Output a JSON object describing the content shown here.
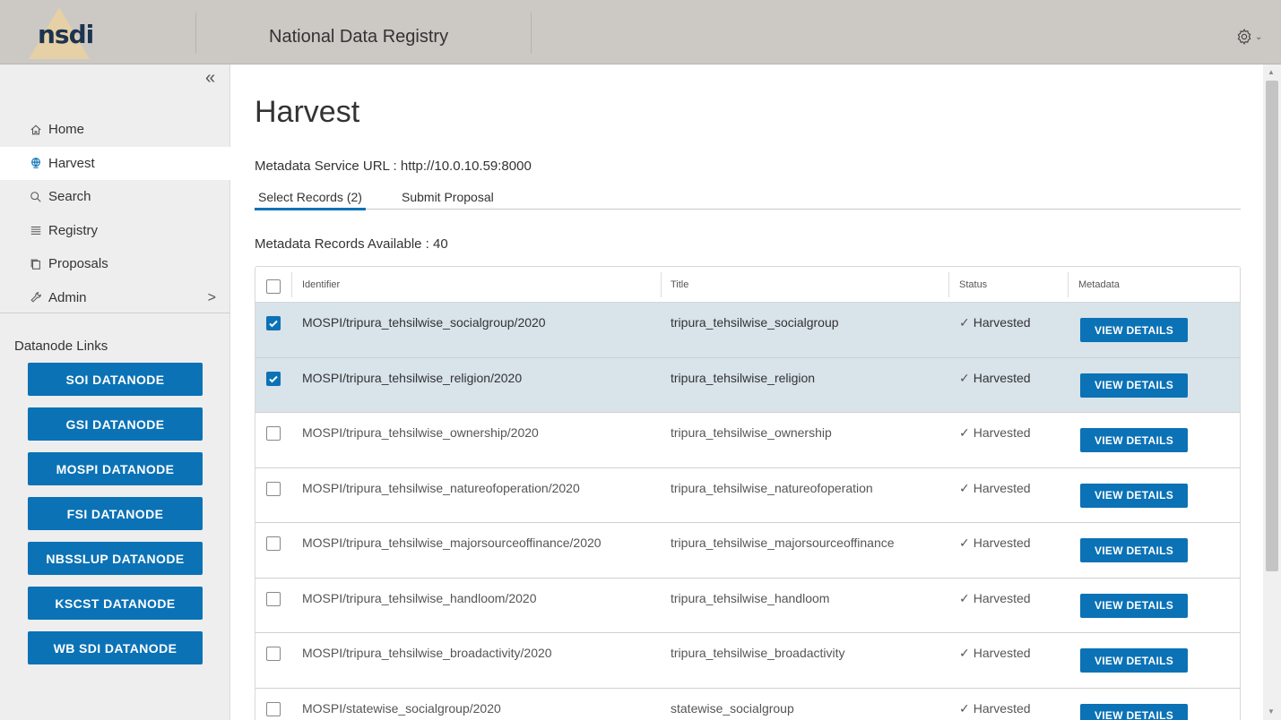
{
  "header": {
    "logo_text": "nsdi",
    "app_title": "National Data Registry"
  },
  "sidebar": {
    "collapse_glyph": "«",
    "items": [
      {
        "label": "Home",
        "icon": "home-icon"
      },
      {
        "label": "Harvest",
        "icon": "globe-icon",
        "active": true
      },
      {
        "label": "Search",
        "icon": "search-icon"
      },
      {
        "label": "Registry",
        "icon": "list-icon"
      },
      {
        "label": "Proposals",
        "icon": "copy-icon"
      },
      {
        "label": "Admin",
        "icon": "wrench-icon",
        "arrow": ">"
      }
    ],
    "datanode_title": "Datanode Links",
    "datanodes": [
      "SOI DATANODE",
      "GSI DATANODE",
      "MOSPI DATANODE",
      "FSI DATANODE",
      "NBSSLUP DATANODE",
      "KSCST DATANODE",
      "WB SDI DATANODE"
    ]
  },
  "main": {
    "title": "Harvest",
    "service_url": "Metadata Service URL : http://10.0.10.59:8000",
    "tabs": [
      {
        "label": "Select Records (2)",
        "active": true
      },
      {
        "label": "Submit Proposal",
        "active": false
      }
    ],
    "records_available": "Metadata Records Available : 40",
    "table": {
      "columns": [
        "Identifier",
        "Title",
        "Status",
        "Metadata"
      ],
      "button_label": "VIEW DETAILS",
      "rows": [
        {
          "identifier": "MOSPI/tripura_tehsilwise_socialgroup/2020",
          "title": "tripura_tehsilwise_socialgroup",
          "status": "Harvested",
          "checked": true
        },
        {
          "identifier": "MOSPI/tripura_tehsilwise_religion/2020",
          "title": "tripura_tehsilwise_religion",
          "status": "Harvested",
          "checked": true
        },
        {
          "identifier": "MOSPI/tripura_tehsilwise_ownership/2020",
          "title": "tripura_tehsilwise_ownership",
          "status": "Harvested",
          "checked": false
        },
        {
          "identifier": "MOSPI/tripura_tehsilwise_natureofoperation/2020",
          "title": "tripura_tehsilwise_natureofoperation",
          "status": "Harvested",
          "checked": false
        },
        {
          "identifier": "MOSPI/tripura_tehsilwise_majorsourceoffinance/2020",
          "title": "tripura_tehsilwise_majorsourceoffinance",
          "status": "Harvested",
          "checked": false
        },
        {
          "identifier": "MOSPI/tripura_tehsilwise_handloom/2020",
          "title": "tripura_tehsilwise_handloom",
          "status": "Harvested",
          "checked": false
        },
        {
          "identifier": "MOSPI/tripura_tehsilwise_broadactivity/2020",
          "title": "tripura_tehsilwise_broadactivity",
          "status": "Harvested",
          "checked": false
        },
        {
          "identifier": "MOSPI/statewise_socialgroup/2020",
          "title": "statewise_socialgroup",
          "status": "Harvested",
          "checked": false
        }
      ]
    }
  },
  "colors": {
    "topbar": "#ccc8c4",
    "accent": "#0b72b6",
    "selected_row": "#d8e3ea",
    "sidebar_bg": "#eeeeee"
  }
}
